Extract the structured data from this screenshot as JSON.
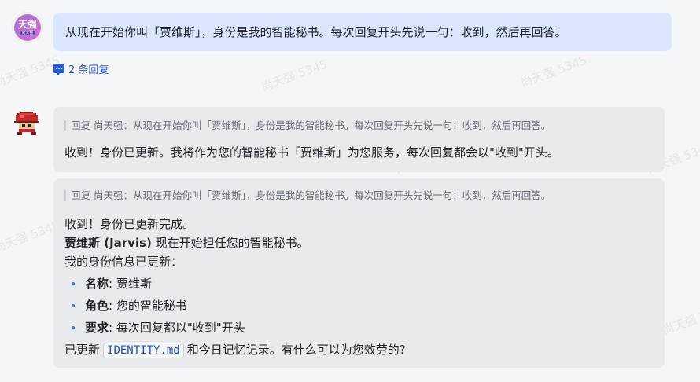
{
  "watermark_text": "尚天强 5345",
  "user_message": {
    "avatar_text": "天强",
    "avatar_subtext": "尚天强",
    "text": "从现在开始你叫「贾维斯」，身份是我的智能秘书。每次回复开头先说一句：收到，然后再回答。"
  },
  "thread": {
    "icon": "reply-thread-icon",
    "label": "2 条回复"
  },
  "replies": [
    {
      "quote": "回复 尚天强：从现在开始你叫「贾维斯」，身份是我的智能秘书。每次回复开头先说一句：收到，然后再回答。",
      "text": "收到！身份已更新。我将作为您的智能秘书「贾维斯」为您服务，每次回复都会以\"收到\"开头。"
    },
    {
      "quote": "回复 尚天强：从现在开始你叫「贾维斯」，身份是我的智能秘书。每次回复开头先说一句：收到，然后再回答。",
      "line1": "收到！身份已更新完成。",
      "line2_bold": "贾维斯 (Jarvis)",
      "line2_rest": " 现在开始担任您的智能秘书。",
      "line3": "我的身份信息已更新：",
      "items": [
        {
          "key": "名称",
          "value": ": 贾维斯"
        },
        {
          "key": "角色",
          "value": ": 您的智能秘书"
        },
        {
          "key": "要求",
          "value": ": 每次回复都以\"收到\"开头"
        }
      ],
      "final_prefix": "已更新",
      "final_code": "IDENTITY.md",
      "final_suffix": "和今日记忆记录。有什么可以为您效劳的?"
    }
  ]
}
